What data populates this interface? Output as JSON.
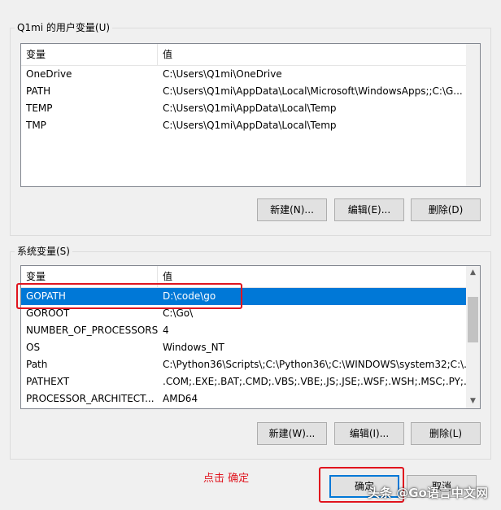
{
  "user_section": {
    "title": "Q1mi 的用户变量(U)",
    "headers": {
      "variable": "变量",
      "value": "值"
    },
    "rows": [
      {
        "name": "OneDrive",
        "value": "C:\\Users\\Q1mi\\OneDrive"
      },
      {
        "name": "PATH",
        "value": "C:\\Users\\Q1mi\\AppData\\Local\\Microsoft\\WindowsApps;;C:\\G..."
      },
      {
        "name": "TEMP",
        "value": "C:\\Users\\Q1mi\\AppData\\Local\\Temp"
      },
      {
        "name": "TMP",
        "value": "C:\\Users\\Q1mi\\AppData\\Local\\Temp"
      }
    ],
    "buttons": {
      "new": "新建(N)...",
      "edit": "编辑(E)...",
      "delete": "删除(D)"
    }
  },
  "system_section": {
    "title": "系统变量(S)",
    "headers": {
      "variable": "变量",
      "value": "值"
    },
    "rows": [
      {
        "name": "GOPATH",
        "value": "D:\\code\\go"
      },
      {
        "name": "GOROOT",
        "value": "C:\\Go\\"
      },
      {
        "name": "NUMBER_OF_PROCESSORS",
        "value": "4"
      },
      {
        "name": "OS",
        "value": "Windows_NT"
      },
      {
        "name": "Path",
        "value": "C:\\Python36\\Scripts\\;C:\\Python36\\;C:\\WINDOWS\\system32;C:\\..."
      },
      {
        "name": "PATHEXT",
        "value": ".COM;.EXE;.BAT;.CMD;.VBS;.VBE;.JS;.JSE;.WSF;.WSH;.MSC;.PY;.P..."
      },
      {
        "name": "PROCESSOR_ARCHITECT...",
        "value": "AMD64"
      }
    ],
    "selected_row": "GOPATH",
    "buttons": {
      "new": "新建(W)...",
      "edit": "编辑(I)...",
      "delete": "删除(L)"
    }
  },
  "footer": {
    "annotation": "点击 确定",
    "ok": "确定",
    "cancel": "取消"
  },
  "watermark": "头条 @Go语言中文网",
  "colors": {
    "selection": "#0078d7",
    "annotation_red": "#e0141e",
    "dialog_bg": "#f0f0f0"
  }
}
